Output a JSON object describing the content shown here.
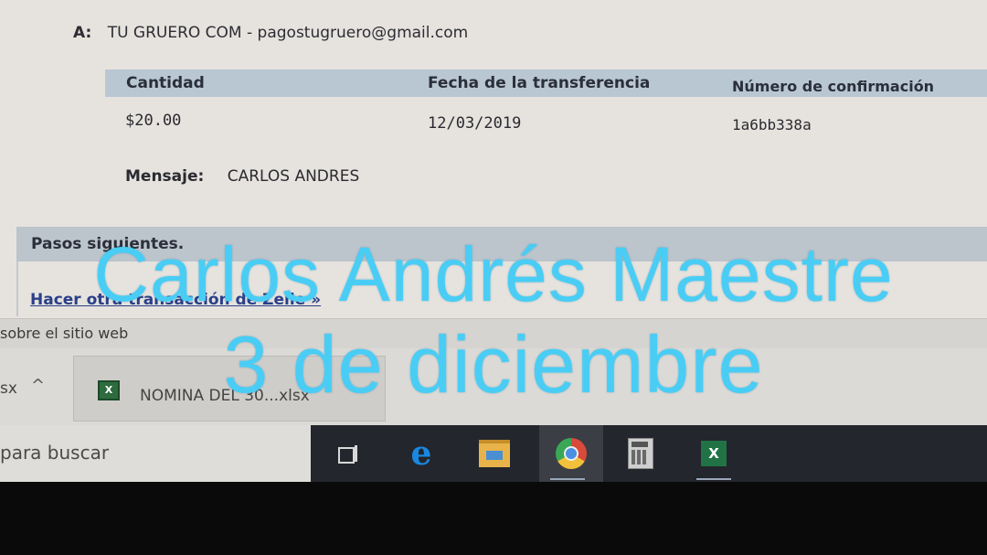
{
  "recipient": {
    "label": "A:",
    "value": "TU GRUERO COM - pagostugruero@gmail.com"
  },
  "transfer_table": {
    "headers": [
      "Cantidad",
      "Fecha de la transferencia",
      "Número de confirmación"
    ],
    "row": [
      "$20.00",
      "12/03/2019",
      "1a6bb338a"
    ]
  },
  "message": {
    "label": "Mensaje:",
    "value": "CARLOS ANDRES"
  },
  "next_steps": {
    "title": "Pasos siguientes.",
    "link": "Hacer otra transacción de Zelle »"
  },
  "status_bar": {
    "text": "sobre el sitio web"
  },
  "downloads_bar": {
    "left_text": "sx",
    "item_name": "NOMINA DEL 30...xlsx"
  },
  "taskbar": {
    "search_placeholder": "para buscar",
    "apps": [
      "task-view",
      "edge",
      "file-explorer",
      "chrome",
      "calculator",
      "excel"
    ],
    "active_app": "chrome",
    "bg_color": "#23262c"
  },
  "overlay_text": {
    "line1": "Carlos Andrés Maestre",
    "line2": "3 de diciembre",
    "color": "#49cdf5"
  }
}
